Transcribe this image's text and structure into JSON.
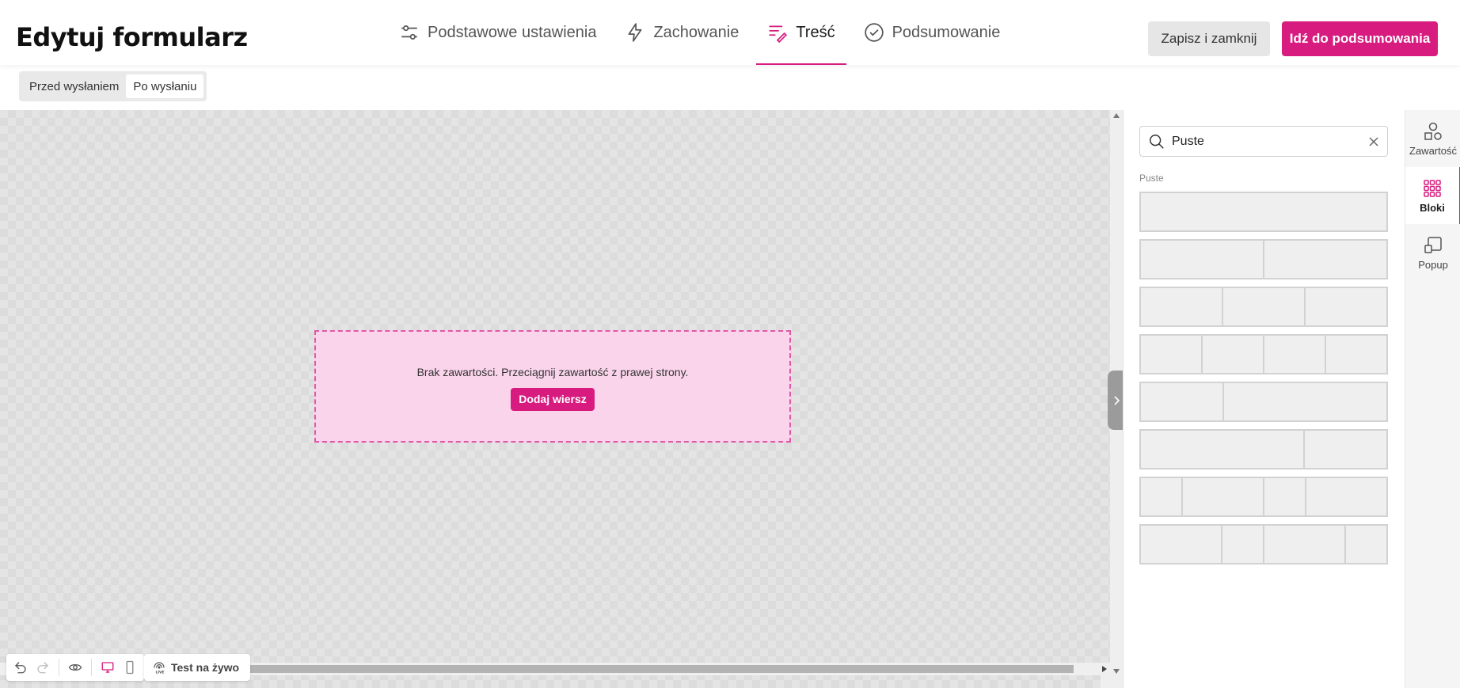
{
  "header": {
    "title": "Edytuj formularz",
    "tabs": [
      {
        "label": "Podstawowe ustawienia",
        "icon": "sliders-icon"
      },
      {
        "label": "Zachowanie",
        "icon": "lightning-icon"
      },
      {
        "label": "Treść",
        "icon": "content-edit-icon",
        "active": true
      },
      {
        "label": "Podsumowanie",
        "icon": "check-circle-icon"
      }
    ],
    "save_close_label": "Zapisz i zamknij",
    "summary_label": "Idź do podsumowania"
  },
  "subbar": {
    "options": [
      "Przed wysłaniem",
      "Po wysłaniu"
    ],
    "selected": "Po wysłaniu"
  },
  "canvas": {
    "empty_text": "Brak zawartości. Przeciągnij zawartość z prawej strony.",
    "add_row_label": "Dodaj wiersz"
  },
  "bottom_tools": {
    "icons": [
      "undo-icon",
      "redo-icon",
      "preview-eye-icon",
      "desktop-icon",
      "mobile-icon"
    ],
    "test_live_label": "Test na żywo"
  },
  "panel": {
    "search_value": "Puste",
    "section_label": "Puste",
    "blocks": [
      [
        1
      ],
      [
        1,
        1
      ],
      [
        1,
        1,
        1
      ],
      [
        1,
        1,
        1,
        1
      ],
      [
        1,
        2
      ],
      [
        2,
        1
      ],
      [
        1,
        2,
        1,
        2
      ],
      [
        2,
        1,
        2,
        1
      ]
    ]
  },
  "side_tabs": [
    {
      "label": "Zawartość",
      "icon": "shapes-icon"
    },
    {
      "label": "Bloki",
      "icon": "grid-icon",
      "active": true
    },
    {
      "label": "Popup",
      "icon": "popup-icon"
    }
  ],
  "colors": {
    "accent": "#d81b7f",
    "dropzone": "#fad4eb"
  }
}
